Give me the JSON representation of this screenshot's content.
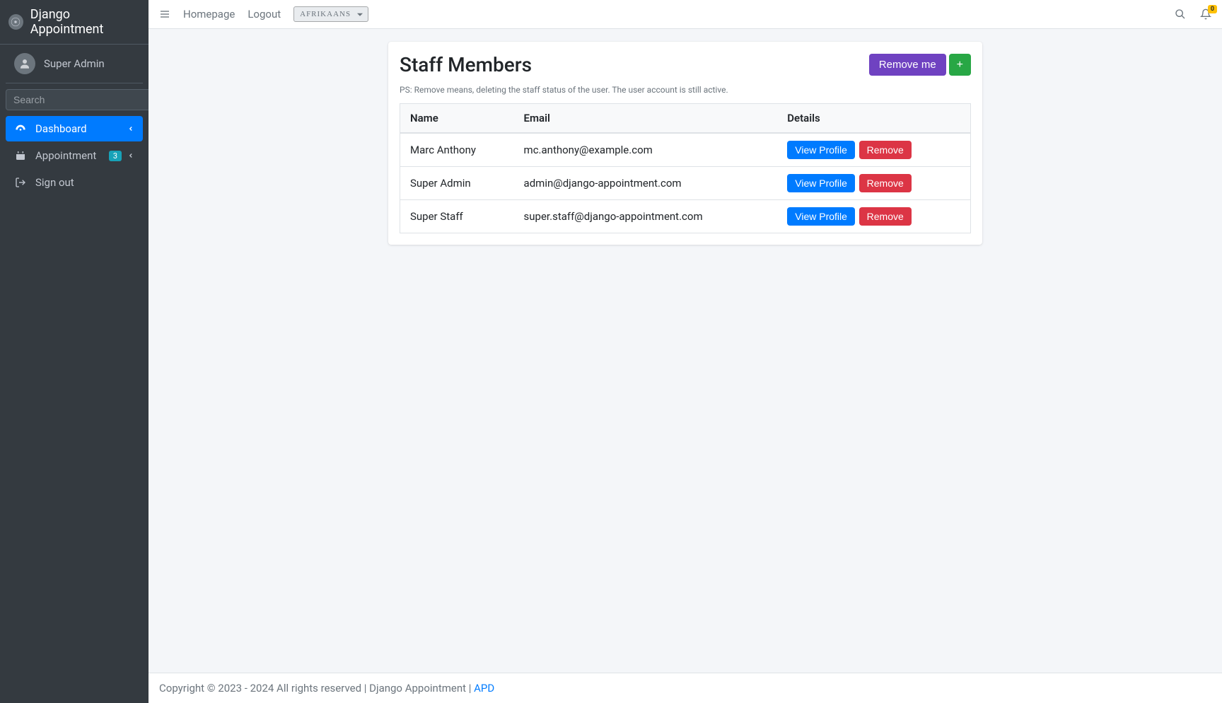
{
  "brand": {
    "title": "Django Appointment"
  },
  "user": {
    "name": "Super Admin"
  },
  "search": {
    "placeholder": "Search"
  },
  "sidebar": {
    "items": [
      {
        "label": "Dashboard",
        "icon": "tachometer",
        "active": true,
        "hasChevron": true
      },
      {
        "label": "Appointment",
        "icon": "calendar",
        "badge": "3",
        "hasChevron": true
      },
      {
        "label": "Sign out",
        "icon": "signout"
      }
    ]
  },
  "topnav": {
    "homepage": "Homepage",
    "logout": "Logout",
    "language_selected": "AFRIKAANS",
    "notification_count": "0"
  },
  "page": {
    "title": "Staff Members",
    "remove_me": "Remove me",
    "note": "PS: Remove means, deleting the staff status of the user. The user account is still active.",
    "table": {
      "headers": {
        "name": "Name",
        "email": "Email",
        "details": "Details"
      },
      "view_label": "View Profile",
      "remove_label": "Remove",
      "rows": [
        {
          "name": "Marc Anthony",
          "email": "mc.anthony@example.com"
        },
        {
          "name": "Super Admin",
          "email": "admin@django-appointment.com"
        },
        {
          "name": "Super Staff",
          "email": "super.staff@django-appointment.com"
        }
      ]
    }
  },
  "footer": {
    "text": "Copyright © 2023 - 2024 All rights reserved | Django Appointment | ",
    "link": "APD"
  }
}
